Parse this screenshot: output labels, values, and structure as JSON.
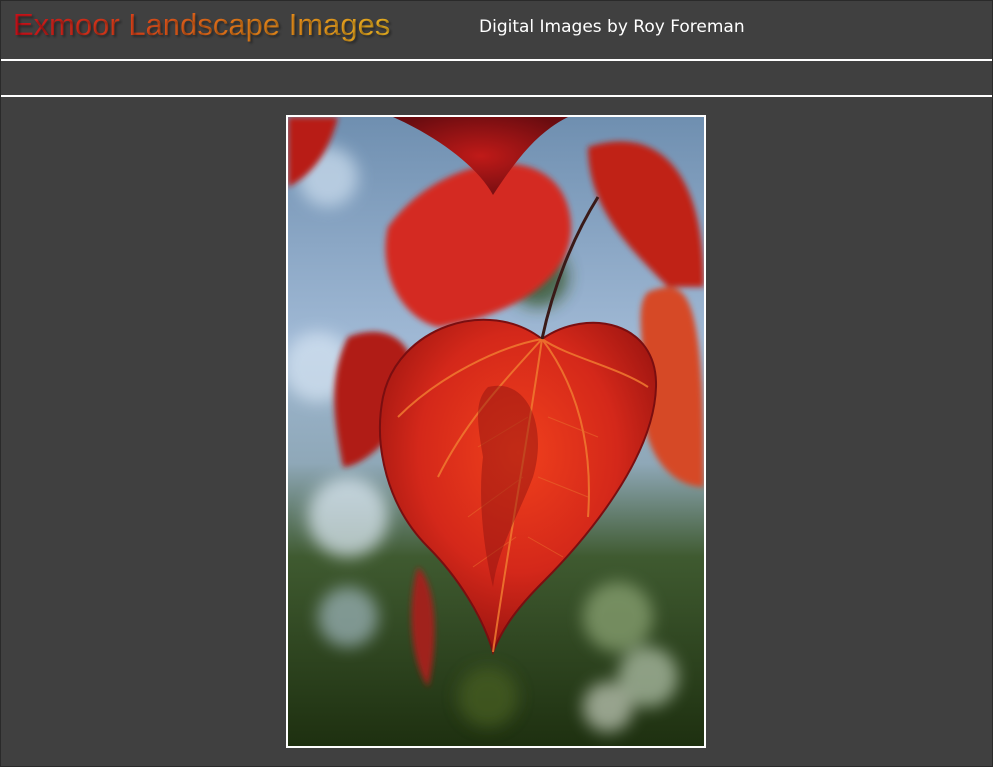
{
  "header": {
    "title": "Exmoor Landscape Images",
    "subtitle": "Digital Images by Roy Foreman"
  },
  "photo": {
    "subject": "red-heart-leaf",
    "colors": {
      "background": "#404040",
      "border": "#ffffff",
      "leaf": "#d42a1a"
    }
  }
}
